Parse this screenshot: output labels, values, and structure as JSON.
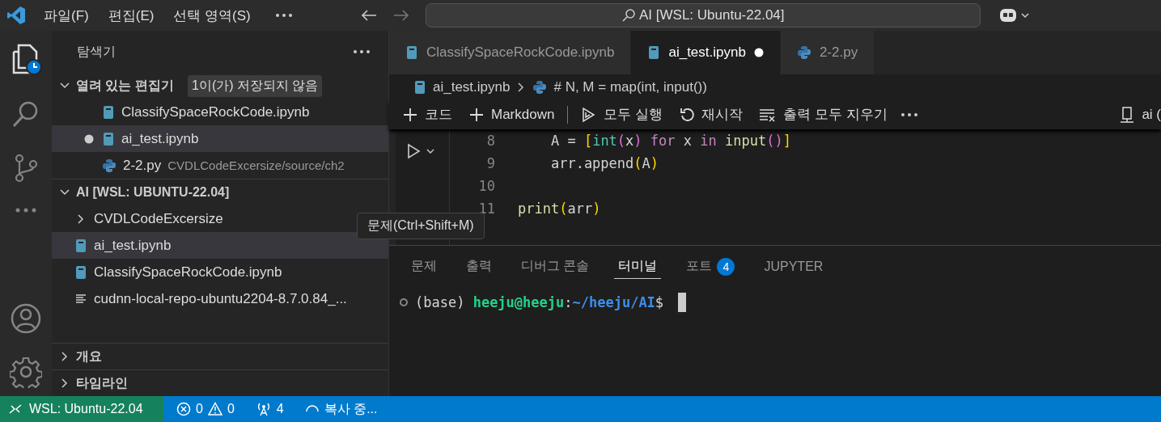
{
  "title_bar": {
    "menu": [
      "파일(F)",
      "편집(E)",
      "선택 영역(S)"
    ],
    "command_center": "AI [WSL: Ubuntu-22.04]"
  },
  "sidebar": {
    "title": "탐색기",
    "sections": [
      {
        "title": "열려 있는 편집기",
        "expanded": true,
        "badge": "1이(가) 저장되지 않음",
        "items": [
          {
            "kind": "notebook",
            "name": "ClassifySpaceRockCode.ipynb",
            "dirty": false,
            "selected": false
          },
          {
            "kind": "notebook",
            "name": "ai_test.ipynb",
            "dirty": true,
            "selected": true
          },
          {
            "kind": "python",
            "name": "2-2.py",
            "description": "CVDLCodeExcersize/source/ch2",
            "dirty": false,
            "selected": false
          }
        ]
      },
      {
        "title": "AI [WSL: UBUNTU-22.04]",
        "expanded": true,
        "items": [
          {
            "kind": "folder",
            "name": "CVDLCodeExcersize",
            "selected": false
          },
          {
            "kind": "notebook",
            "name": "ai_test.ipynb",
            "selected": true
          },
          {
            "kind": "notebook",
            "name": "ClassifySpaceRockCode.ipynb",
            "selected": false
          },
          {
            "kind": "file",
            "name": "cudnn-local-repo-ubuntu2204-8.7.0.84_...",
            "selected": false
          }
        ]
      },
      {
        "title": "개요",
        "expanded": false
      },
      {
        "title": "타임라인",
        "expanded": false
      }
    ]
  },
  "editor": {
    "tabs": [
      {
        "kind": "notebook",
        "label": "ClassifySpaceRockCode.ipynb",
        "selected": false,
        "dirty": false
      },
      {
        "kind": "notebook",
        "label": "ai_test.ipynb",
        "selected": true,
        "dirty": true
      },
      {
        "kind": "python",
        "label": "2-2.py",
        "selected": false,
        "dirty": false
      }
    ],
    "breadcrumb": [
      "ai_test.ipynb",
      "# N, M = map(int, input())"
    ],
    "toolbar": [
      {
        "kind": "plus",
        "label": "코드"
      },
      {
        "kind": "plus",
        "label": "Markdown"
      },
      {
        "kind": "run",
        "label": "모두 실행"
      },
      {
        "kind": "restart",
        "label": "재시작"
      },
      {
        "kind": "clear",
        "label": "출력 모두 지우기"
      }
    ],
    "kernel": "ai (",
    "code_lines": [
      {
        "number": "8",
        "tokens": [
          {
            "kind": "plain",
            "text": "    A = "
          },
          {
            "kind": "bracket1",
            "text": "["
          },
          {
            "kind": "builtin",
            "text": "int"
          },
          {
            "kind": "bracket2",
            "text": "("
          },
          {
            "kind": "plain",
            "text": "x"
          },
          {
            "kind": "bracket2",
            "text": ")"
          },
          {
            "kind": "keyword",
            "text": " for "
          },
          {
            "kind": "plain",
            "text": "x"
          },
          {
            "kind": "keyword",
            "text": " in "
          },
          {
            "kind": "func",
            "text": "input"
          },
          {
            "kind": "bracket2",
            "text": "()"
          },
          {
            "kind": "bracket1",
            "text": "]"
          }
        ]
      },
      {
        "number": "9",
        "tokens": [
          {
            "kind": "plain",
            "text": "    arr.append"
          },
          {
            "kind": "bracket1",
            "text": "("
          },
          {
            "kind": "plain",
            "text": "A"
          },
          {
            "kind": "bracket1",
            "text": ")"
          }
        ]
      },
      {
        "number": "10"
      },
      {
        "number": "11",
        "tokens": [
          {
            "kind": "func",
            "text": "print"
          },
          {
            "kind": "bracket1",
            "text": "("
          },
          {
            "kind": "plain",
            "text": "arr"
          },
          {
            "kind": "bracket1",
            "text": ")"
          }
        ]
      }
    ],
    "tooltip": "문제(Ctrl+Shift+M)"
  },
  "panel": {
    "tabs": [
      {
        "label": "문제",
        "selected": false
      },
      {
        "label": "출력",
        "selected": false
      },
      {
        "label": "디버그 콘솔",
        "selected": false
      },
      {
        "label": "터미널",
        "selected": true
      },
      {
        "label": "포트",
        "selected": false,
        "badge": "4"
      },
      {
        "label": "JUPYTER",
        "selected": false
      }
    ],
    "terminal": [
      {
        "kind": "plain",
        "text": "(base) "
      },
      {
        "kind": "user",
        "text": "heeju@heeju"
      },
      {
        "kind": "plain",
        "text": ":"
      },
      {
        "kind": "path",
        "text": "~/heeju/AI"
      },
      {
        "kind": "plain",
        "text": "$ "
      }
    ]
  },
  "status_bar": {
    "remote": "WSL: Ubuntu-22.04",
    "errors": "0",
    "warnings": "0",
    "ports": "4",
    "progress": "복사 중..."
  }
}
